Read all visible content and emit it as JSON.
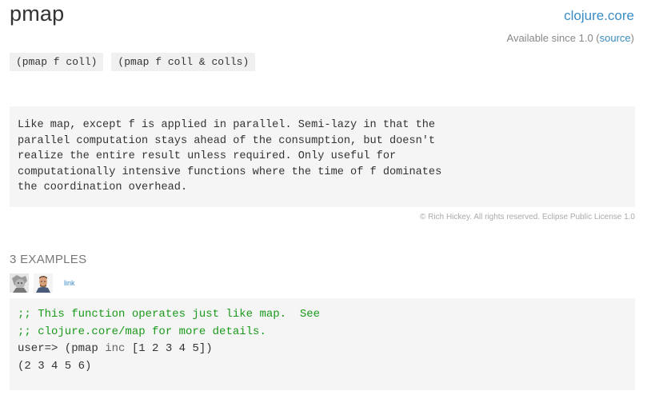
{
  "header": {
    "title": "pmap",
    "namespace": "clojure.core",
    "since_prefix": "Available since 1.0 (",
    "source_label": "source",
    "since_suffix": ")"
  },
  "arglists": [
    "(pmap f coll)",
    "(pmap f coll & colls)"
  ],
  "docstring": "Like map, except f is applied in parallel. Semi-lazy in that the\nparallel computation stays ahead of the consumption, but doesn't\nrealize the entire result unless required. Only useful for\ncomputationally intensive functions where the time of f dominates\nthe coordination overhead.",
  "copyright": "© Rich Hickey. All rights reserved. Eclipse Public License 1.0",
  "examples": {
    "header": "3 EXAMPLES",
    "link_label": "link",
    "code": {
      "comment1": ";; This function operates just like map.  See",
      "comment2": ";; clojure.core/map for more details.",
      "prompt": "user=> (pmap ",
      "fn": "inc",
      "args": " [1 2 3 4 5])",
      "result": "(2 3 4 5 6)"
    }
  },
  "colors": {
    "link": "#3a8cc4",
    "comment": "#1a9a1a",
    "panel_bg": "#f5f5f5"
  }
}
